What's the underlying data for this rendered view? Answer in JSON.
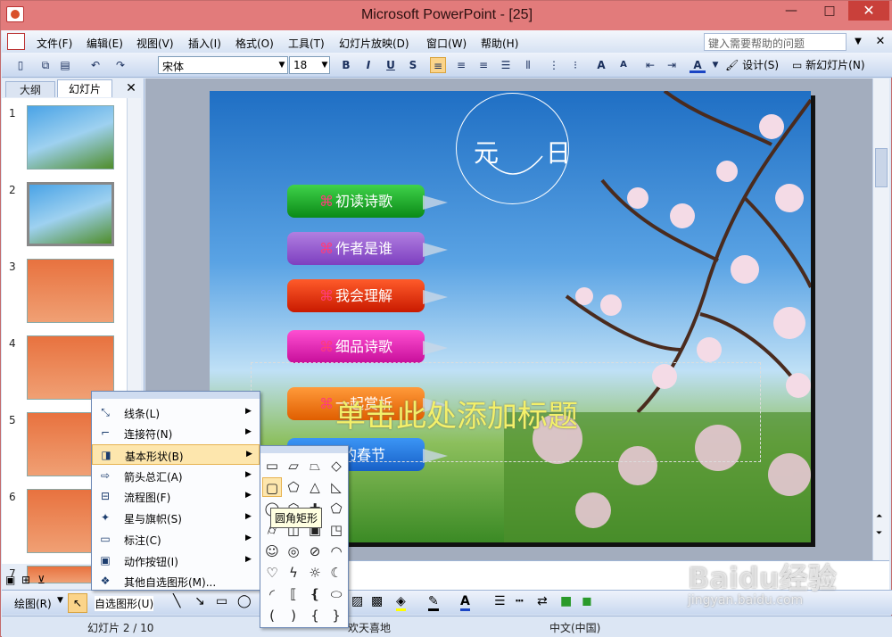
{
  "window": {
    "title": "Microsoft PowerPoint - [25]"
  },
  "menubar": {
    "items": [
      "文件(F)",
      "编辑(E)",
      "视图(V)",
      "插入(I)",
      "格式(O)",
      "工具(T)",
      "幻灯片放映(D)",
      "窗口(W)",
      "帮助(H)"
    ],
    "help_placeholder": "键入需要帮助的问题"
  },
  "toolbar": {
    "font": "宋体",
    "size": "18",
    "bold": "B",
    "italic": "I",
    "underline": "U",
    "shadow": "S",
    "design": "设计(S)",
    "new_slide": "新幻灯片(N)"
  },
  "panel": {
    "tab_outline": "大纲",
    "tab_slides": "幻灯片",
    "slide_numbers": [
      "1",
      "2",
      "3",
      "4",
      "5",
      "6",
      "7"
    ]
  },
  "slide": {
    "smiley_text": "元 日",
    "buttons": [
      "初读诗歌",
      "作者是谁",
      "我会理解",
      "细品诗歌",
      "一起赏析",
      "的春节"
    ],
    "button_symbol": "⌘",
    "title_placeholder": "单击此处添加标题"
  },
  "autoshape_menu": {
    "items": [
      {
        "label": "线条(L)",
        "icon": "⤡"
      },
      {
        "label": "连接符(N)",
        "icon": "⌐"
      },
      {
        "label": "基本形状(B)",
        "icon": "◨"
      },
      {
        "label": "箭头总汇(A)",
        "icon": "⇨"
      },
      {
        "label": "流程图(F)",
        "icon": "⊟"
      },
      {
        "label": "星与旗帜(S)",
        "icon": "✦"
      },
      {
        "label": "标注(C)",
        "icon": "▭"
      },
      {
        "label": "动作按钮(I)",
        "icon": "▣"
      },
      {
        "label": "其他自选图形(M)...",
        "icon": "❖"
      }
    ]
  },
  "shapes_palette": {
    "tooltip": "圆角矩形"
  },
  "drawbar": {
    "draw": "绘图(R)",
    "autoshapes": "自选图形(U)"
  },
  "status": {
    "slide": "幻灯片 2 / 10",
    "theme": "欢天喜地",
    "language": "中文(中国)"
  },
  "watermark": {
    "brand": "Baidu经验",
    "url": "jingyan.baidu.com"
  }
}
